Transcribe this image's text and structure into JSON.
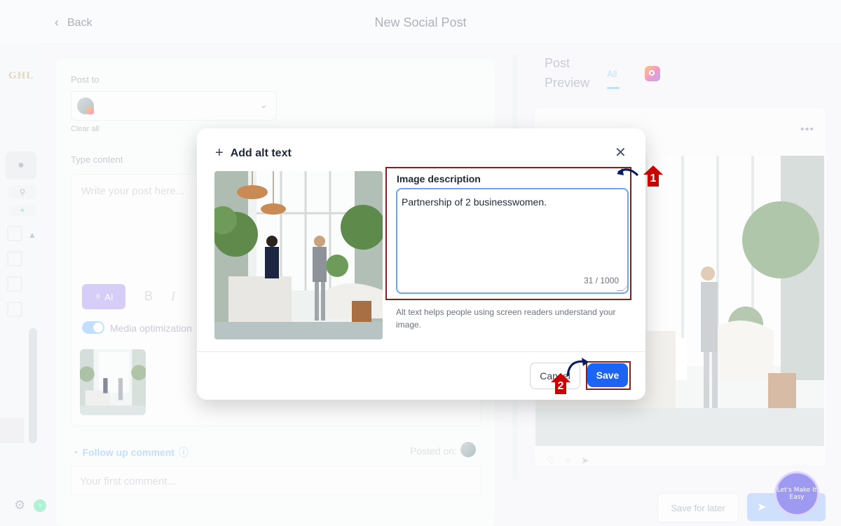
{
  "header": {
    "back_label": "Back",
    "title": "New Social Post"
  },
  "rail": {
    "logo": "GHL"
  },
  "composer": {
    "post_to_label": "Post to",
    "clear_all": "Clear all",
    "type_content_label": "Type content",
    "content_placeholder": "Write your post here...",
    "ai_label": "AI",
    "format_bold": "B",
    "format_italic": "I",
    "media_optimization": "Media optimization",
    "follow_up_label": "Follow up comment",
    "posted_on_label": "Posted on:",
    "comment_placeholder": "Your first comment..."
  },
  "preview": {
    "title": "Post Preview",
    "tab_all": "All",
    "save_later": "Save for later"
  },
  "modal": {
    "title": "Add alt text",
    "description_label": "Image description",
    "description_value": "Partnership of 2 businesswomen.",
    "counter": "31 / 1000",
    "helper": "Alt text helps people using screen readers understand your image.",
    "cancel_label": "Cancel",
    "save_label": "Save"
  },
  "annotations": {
    "step1": "1",
    "step2": "2"
  },
  "brand_badge": "Let's Make It Easy",
  "colors": {
    "primary": "#1d64f2",
    "highlight": "#8b1c1c",
    "step_marker": "#cc0000",
    "ai_purple": "#b7a4f5"
  }
}
